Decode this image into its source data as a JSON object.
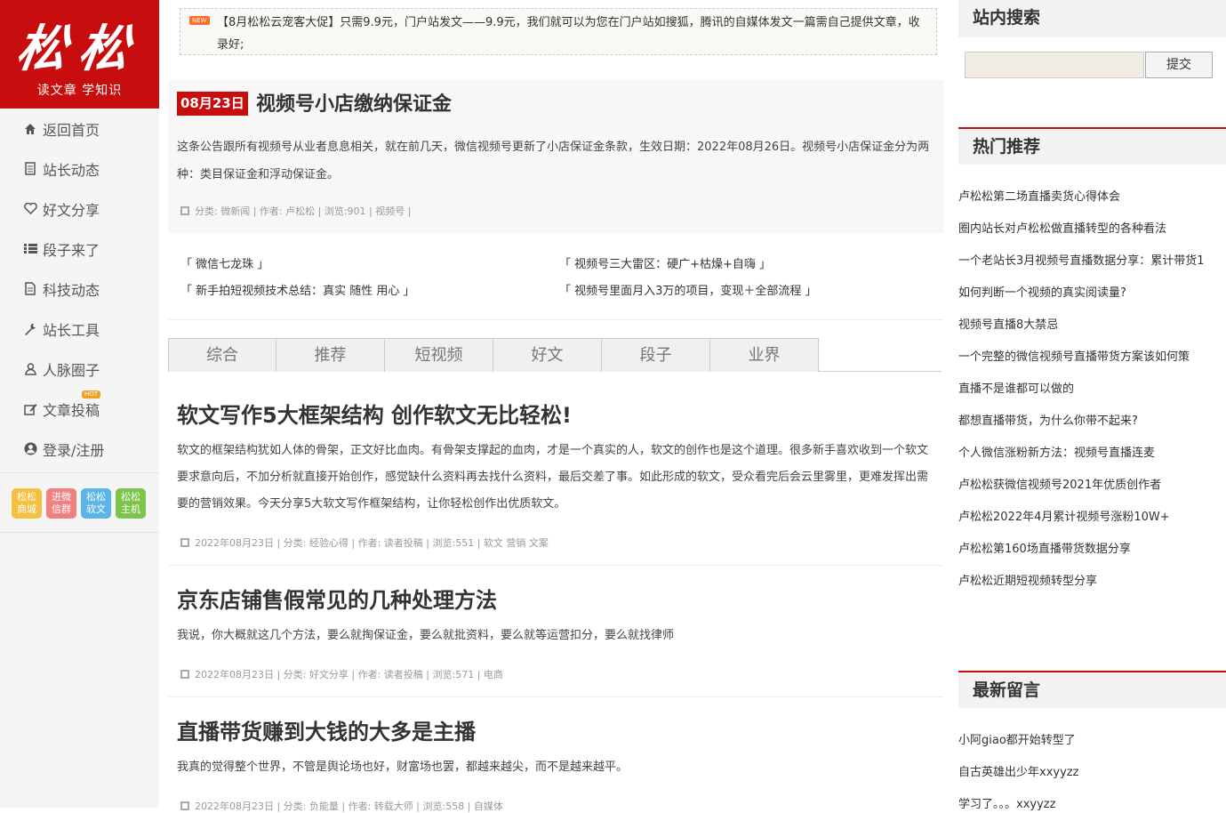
{
  "logo": {
    "main": "松松",
    "sub": "读文章 学知识"
  },
  "nav": [
    {
      "label": "返回首页",
      "icon": "home-icon"
    },
    {
      "label": "站长动态",
      "icon": "document-icon"
    },
    {
      "label": "好文分享",
      "icon": "heart-icon"
    },
    {
      "label": "段子来了",
      "icon": "list-icon"
    },
    {
      "label": "科技动态",
      "icon": "file-icon"
    },
    {
      "label": "站长工具",
      "icon": "wrench-icon"
    },
    {
      "label": "人脉圈子",
      "icon": "user-icon"
    },
    {
      "label": "文章投稿",
      "icon": "edit-icon",
      "badge": "HOT"
    },
    {
      "label": "登录/注册",
      "icon": "account-icon"
    }
  ],
  "tiles": [
    {
      "line1": "松松",
      "line2": "商城",
      "color": "#f5c040"
    },
    {
      "line1": "进微",
      "line2": "信群",
      "color": "#f08080"
    },
    {
      "line1": "松松",
      "line2": "软文",
      "color": "#5bb5e8"
    },
    {
      "line1": "松松",
      "line2": "主机",
      "color": "#7cc54a"
    }
  ],
  "notice": {
    "badge": "NEW",
    "text": "【8月松松云宠客大促】只需9.9元，门户站发文——9.9元，我们就可以为您在门户站如搜狐，腾讯的自媒体发文一篇需自己提供文章，收录好;"
  },
  "featured": {
    "date": "08月23日",
    "title": "视频号小店缴纳保证金",
    "excerpt": "这条公告跟所有视频号从业者息息相关，就在前几天，微信视频号更新了小店保证金条款，生效日期：2022年08月26日。视频号小店保证金分为两种：类目保证金和浮动保证金。",
    "meta": "分类: 微新闻 | 作者: 卢松松 | 浏览:901 | 视频号 |"
  },
  "related": [
    "「 微信七龙珠 」",
    "「 视频号三大雷区：硬广+枯燥+自嗨 」",
    "「 新手拍短视频技术总结：真实 随性 用心 」",
    "「 视频号里面月入3万的项目，变现＋全部流程 」"
  ],
  "tabs": [
    "综合",
    "推荐",
    "短视频",
    "好文",
    "段子",
    "业界"
  ],
  "articles": [
    {
      "title": "软文写作5大框架结构 创作软文无比轻松!",
      "excerpt": "软文的框架结构犹如人体的骨架，正文好比血肉。有骨架支撑起的血肉，才是一个真实的人，软文的创作也是这个道理。很多新手喜欢收到一个软文要求意向后，不加分析就直接开始创作，感觉缺什么资料再去找什么资料，最后交差了事。如此形成的软文，受众看完后会云里雾里，更难发挥出需要的营销效果。今天分享5大软文写作框架结构，让你轻松创作出优质软文。",
      "meta": "2022年08月23日 | 分类: 经验心得 | 作者: 读者投稿 | 浏览:551 | 软文 营销 文案"
    },
    {
      "title": "京东店铺售假常见的几种处理方法",
      "excerpt": "我说，你大概就这几个方法，要么就掏保证金，要么就批资料，要么就等运营扣分，要么就找律师",
      "meta": "2022年08月23日 | 分类: 好文分享 | 作者: 读者投稿 | 浏览:571 | 电商"
    },
    {
      "title": "直播带货赚到大钱的大多是主播",
      "excerpt": "我真的觉得整个世界，不管是舆论场也好，财富场也罢，都越来越尖，而不是越来越平。",
      "meta": "2022年08月23日 | 分类: 负能量 | 作者: 转载大师 | 浏览:558 | 自媒体"
    }
  ],
  "search": {
    "title": "站内搜索",
    "button": "提交",
    "value": ""
  },
  "hot": {
    "title": "热门推荐",
    "items": [
      "卢松松第二场直播卖货心得体会",
      "圈内站长对卢松松做直播转型的各种看法",
      "一个老站长3月视频号直播数据分享：累计带货1",
      "如何判断一个视频的真实阅读量?",
      "视频号直播8大禁忌",
      "一个完整的微信视频号直播带货方案该如何策",
      "直播不是谁都可以做的",
      "都想直播带货，为什么你带不起来?",
      "个人微信涨粉新方法：视频号直播连麦",
      "卢松松获微信视频号2021年优质创作者",
      "卢松松2022年4月累计视频号涨粉10W+",
      "卢松松第160场直播带货数据分享",
      "卢松松近期短视频转型分享"
    ]
  },
  "comments": {
    "title": "最新留言",
    "items": [
      "小阿giao都开始转型了",
      "自古英雄出少年xxyyzz",
      "学习了。。。xxyyzz"
    ]
  },
  "colors": {
    "brand_red": "#c70d0d",
    "sidebar_bg": "#f5f5f5"
  }
}
